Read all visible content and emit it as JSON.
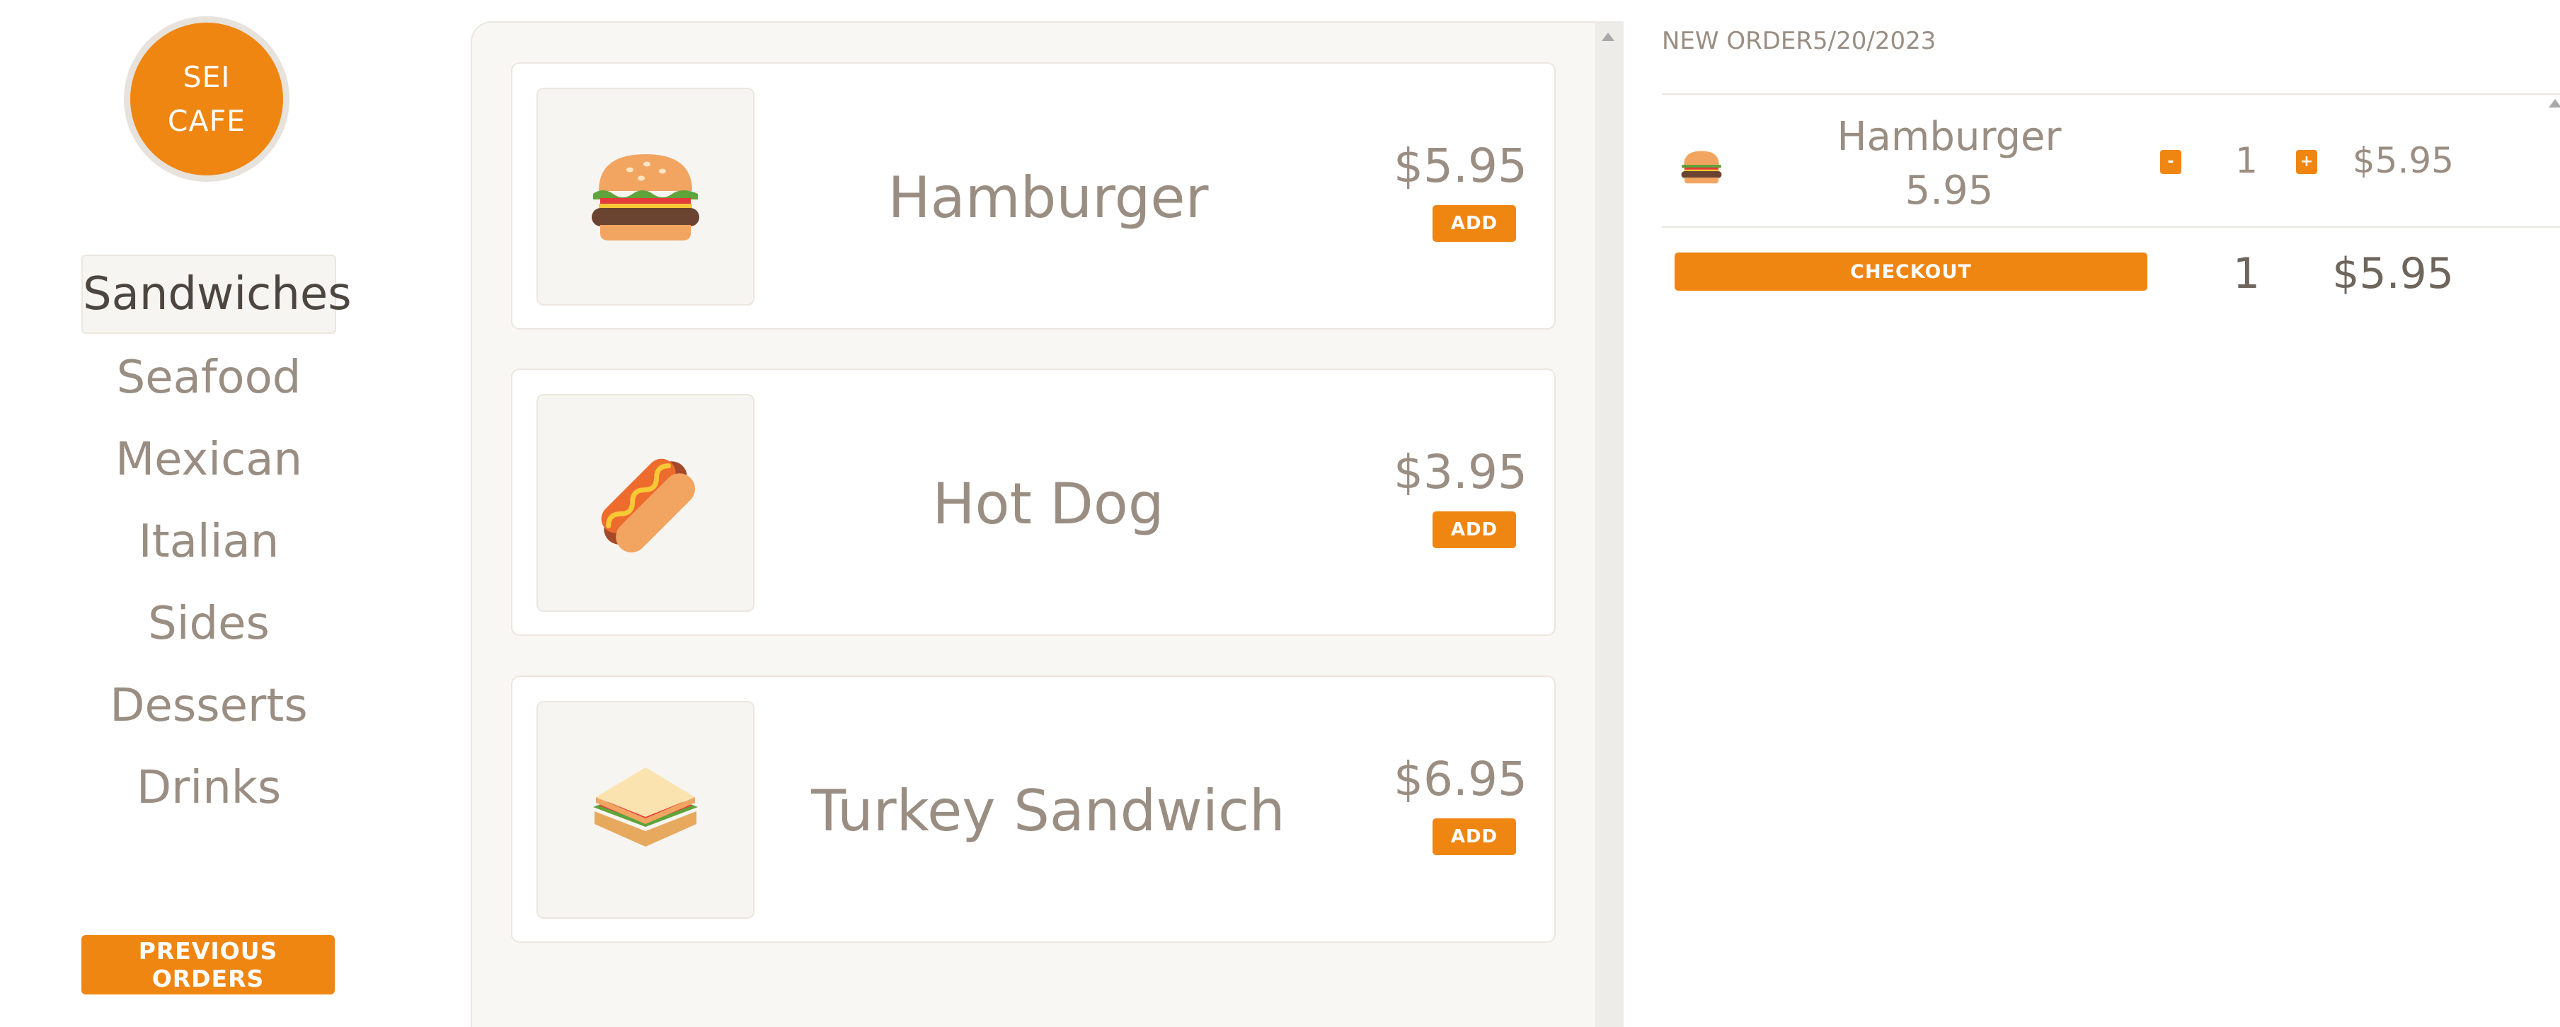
{
  "brand": {
    "line1": "SEI",
    "line2": "CAFE",
    "color": "#f08612"
  },
  "sidebar": {
    "categories": [
      {
        "label": "Sandwiches",
        "active": true
      },
      {
        "label": "Seafood"
      },
      {
        "label": "Mexican"
      },
      {
        "label": "Italian"
      },
      {
        "label": "Sides"
      },
      {
        "label": "Desserts"
      },
      {
        "label": "Drinks"
      }
    ],
    "previous_orders_label": "PREVIOUS ORDERS"
  },
  "menu": {
    "items": [
      {
        "name": "Hamburger",
        "price": "$5.95",
        "add_label": "ADD",
        "icon": "hamburger-icon"
      },
      {
        "name": "Hot Dog",
        "price": "$3.95",
        "add_label": "ADD",
        "icon": "hot-dog-icon"
      },
      {
        "name": "Turkey Sandwich",
        "price": "$6.95",
        "add_label": "ADD",
        "icon": "sandwich-icon"
      }
    ]
  },
  "order": {
    "header_label": "NEW ORDER",
    "date": "5/20/2023",
    "lines": [
      {
        "name": "Hamburger",
        "unit_price": "5.95",
        "minus_label": "-",
        "plus_label": "+",
        "qty": "1",
        "line_total": "$5.95",
        "icon": "hamburger-icon"
      }
    ],
    "checkout_label": "CHECKOUT",
    "total_qty": "1",
    "total_price": "$5.95"
  }
}
